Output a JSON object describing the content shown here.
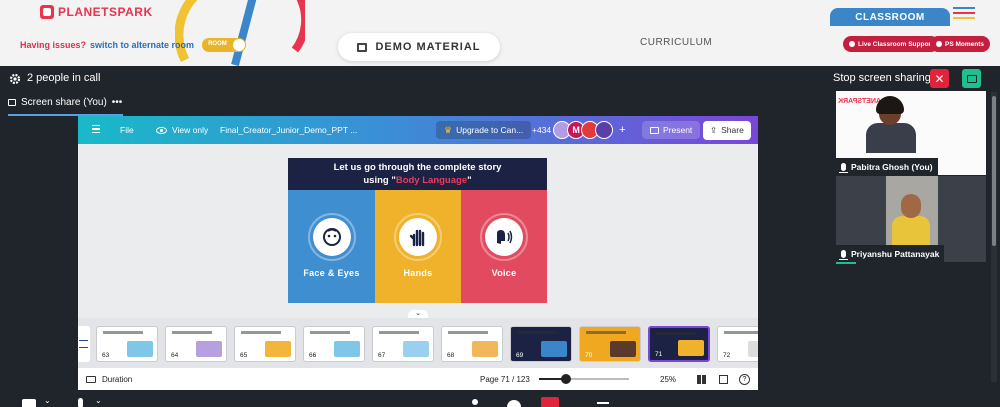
{
  "brand": {
    "logo_text": "PLANETSPARK"
  },
  "header": {
    "issue_text": "Having issues?",
    "alt_room_link": "switch to alternate room",
    "room_toggle_label": "ROOM",
    "demo_material_label": "DEMO MATERIAL",
    "curriculum_label": "CURRICULUM",
    "classroom_tab": "CLASSROOM",
    "live_support_label": "Live Classroom Support",
    "ps_moments_label": "PS Moments"
  },
  "call": {
    "people_count": "2 people in call",
    "stop_sharing_label": "Stop screen sharing",
    "share_tab_label": "Screen share (You)",
    "share_tab_more": "•••"
  },
  "canva": {
    "file_label": "File",
    "view_only_label": "View only",
    "doc_title": "Final_Creator_Junior_Demo_PPT ...",
    "upgrade_label": "Upgrade to Can...",
    "collab_count": "+434",
    "avatar_letter": "M",
    "add_collab": "+",
    "present_label": "Present",
    "share_label": "Share",
    "duration_label": "Duration",
    "page_indicator": "Page 71 / 123",
    "zoom": "25%",
    "help": "?",
    "zoom_level_fraction": 0.3
  },
  "slide": {
    "title_line1": "Let us go through the complete story",
    "title_line2_prefix": "using  \"",
    "title_highlight": "Body Language",
    "title_line2_suffix": "\"",
    "panels": [
      {
        "label": "Face & Eyes",
        "color": "#3f8fd0",
        "icon": "face-icon"
      },
      {
        "label": "Hands",
        "color": "#efb22a",
        "icon": "hand-icon"
      },
      {
        "label": "Voice",
        "color": "#e24a60",
        "icon": "voice-icon"
      }
    ]
  },
  "thumbnails": [
    {
      "num": "63",
      "bg": "#ffffff",
      "art": "#7fc6e8"
    },
    {
      "num": "64",
      "bg": "#ffffff",
      "art": "#b7a0e0"
    },
    {
      "num": "65",
      "bg": "#ffffff",
      "art": "#f2b63c"
    },
    {
      "num": "66",
      "bg": "#ffffff",
      "art": "#7fc6e8"
    },
    {
      "num": "67",
      "bg": "#ffffff",
      "art": "#9ad0ef"
    },
    {
      "num": "68",
      "bg": "#ffffff",
      "art": "#f0b85a"
    },
    {
      "num": "69",
      "bg": "#1b2244",
      "art": "#3a86c9"
    },
    {
      "num": "70",
      "bg": "#efa820",
      "art": "#5a3a2a"
    },
    {
      "num": "71",
      "bg": "#1b2244",
      "art": "#efb22a"
    },
    {
      "num": "72",
      "bg": "#ffffff",
      "art": "#dddddd"
    }
  ],
  "participants": [
    {
      "name": "Pabitra Ghosh (You)"
    },
    {
      "name": "Priyanshu Pattanayak"
    }
  ],
  "colors": {
    "accent_red": "#e0243b",
    "accent_green": "#1fbf8f",
    "classroom_blue": "#3a86c9",
    "canva_purple": "#7a46d8"
  }
}
